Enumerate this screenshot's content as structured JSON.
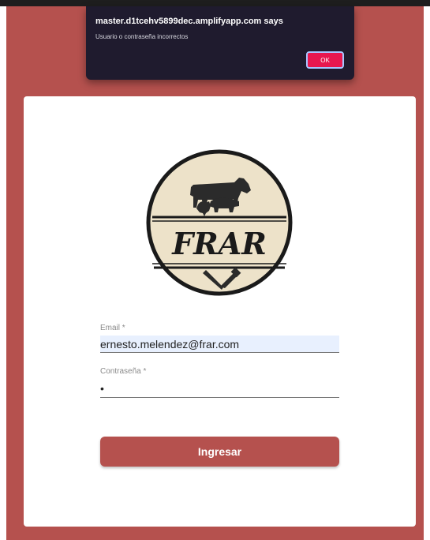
{
  "dialog": {
    "title": "master.d1tcehv5899dec.amplifyapp.com says",
    "message": "Usuario o contraseña incorrectos",
    "ok_label": "OK"
  },
  "logo": {
    "text": "FRAR"
  },
  "form": {
    "email_label": "Email *",
    "email_value": "ernesto.melendez@frar.com",
    "password_label": "Contraseña *",
    "password_value": "•",
    "submit_label": "Ingresar"
  },
  "colors": {
    "brand": "#b5514e",
    "dialog_bg": "#1f1b2e",
    "dialog_ok": "#e8174f",
    "logo_cream": "#ede2c9",
    "autofill": "#e8f0fe"
  }
}
